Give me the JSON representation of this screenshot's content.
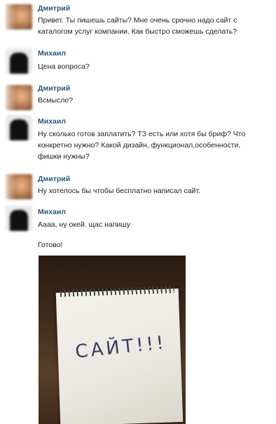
{
  "messages": [
    {
      "author": "Дмитрий",
      "text": "Привет. Ты пишешь сайты? Мне очень срочно надо сайт с каталогом услуг компании. Как быстро сможешь сделать?"
    },
    {
      "author": "Михаил",
      "text": "Цена вопроса?"
    },
    {
      "author": "Дмитрий",
      "text": "Всмысле?"
    },
    {
      "author": "Михаил",
      "text": "Ну сколько готов заплатить? ТЗ есть или хотя бы бриф? Что конкретно нужно? Какой дизайн, функционал,особенности, фишки нужны?"
    },
    {
      "author": "Дмитрий",
      "text": "Ну хотелось бы чтобы бесплатно написал сайт."
    },
    {
      "author": "Михаил",
      "text": "Аааа, ну окей. щас напишу",
      "text2": "Готово!"
    }
  ],
  "photo": {
    "paper_text": "САЙТ!!!"
  },
  "colors": {
    "author": "#2b587a",
    "text": "#222222",
    "background": "#ffffff"
  }
}
